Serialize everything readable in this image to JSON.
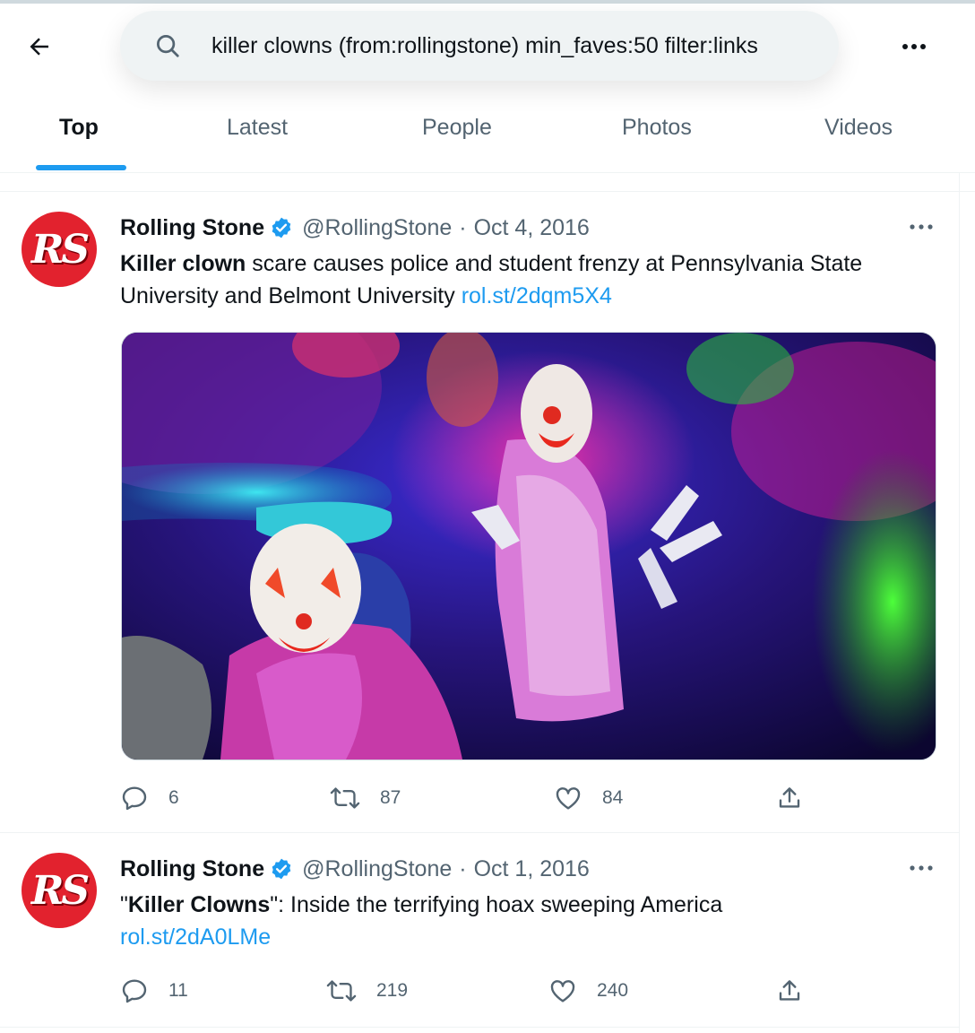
{
  "search": {
    "query": "killer clowns (from:rollingstone) min_faves:50 filter:links"
  },
  "tabs": [
    {
      "label": "Top"
    },
    {
      "label": "Latest"
    },
    {
      "label": "People"
    },
    {
      "label": "Photos"
    },
    {
      "label": "Videos"
    }
  ],
  "tweets": [
    {
      "avatar_text": "RS",
      "author": "Rolling Stone",
      "handle": "@RollingStone",
      "sep": "·",
      "date": "Oct 4, 2016",
      "text_bold": "Killer clown",
      "text_rest": " scare causes police and student frenzy at Pennsylvania State University and Belmont University ",
      "link": "rol.st/2dqm5X4",
      "replies": "6",
      "retweets": "87",
      "likes": "84"
    },
    {
      "avatar_text": "RS",
      "author": "Rolling Stone",
      "handle": "@RollingStone",
      "sep": "·",
      "date": "Oct 1, 2016",
      "text_pre": "\"",
      "text_bold": "Killer Clowns",
      "text_rest": "\": Inside the terrifying hoax sweeping America",
      "link": "rol.st/2dA0LMe",
      "replies": "11",
      "retweets": "219",
      "likes": "240"
    }
  ],
  "colors": {
    "accent": "#1d9bf0",
    "muted": "#536471",
    "avatar_red": "#e2222e"
  },
  "icons": [
    "back-arrow-icon",
    "search-icon",
    "more-icon",
    "verified-icon",
    "reply-icon",
    "retweet-icon",
    "like-icon",
    "share-icon"
  ]
}
